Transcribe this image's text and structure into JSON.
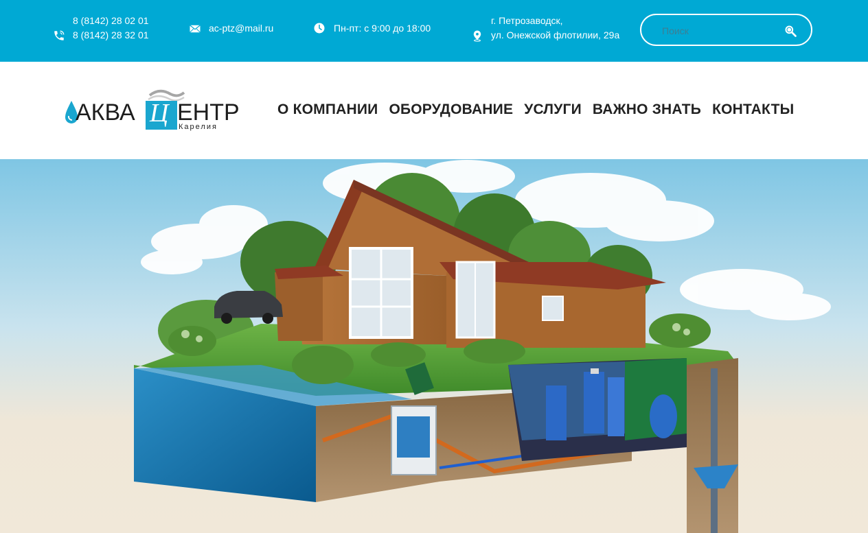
{
  "topbar": {
    "phone_1": "8 (8142) 28 02 01",
    "phone_2": "8 (8142) 28 32 01",
    "email": "ac-ptz@mail.ru",
    "hours": "Пн-пт: с 9:00 до 18:00",
    "address_line_1": "г. Петрозаводск,",
    "address_line_2": "ул. Онежской флотилии, 29а",
    "search_placeholder": "Поиск",
    "icons": [
      "phone-icon",
      "mail-icon",
      "clock-icon",
      "location-pin-icon",
      "search-icon"
    ]
  },
  "header": {
    "logo": {
      "part_1": "АКВА",
      "part_2": "Ц",
      "part_3": "ЕНТР",
      "subtitle": "Карелия"
    },
    "nav": [
      {
        "label": "О КОМПАНИИ"
      },
      {
        "label": "ОБОРУДОВАНИЕ"
      },
      {
        "label": "УСЛУГИ"
      },
      {
        "label": "ВАЖНО ЗНАТЬ"
      },
      {
        "label": "КОНТАКТЫ"
      }
    ]
  },
  "colors": {
    "topbar_bg": "#00a9d4",
    "nav_text": "#222222",
    "logo_accent": "#1aa6cf",
    "logo_text": "#1d1d1d"
  }
}
